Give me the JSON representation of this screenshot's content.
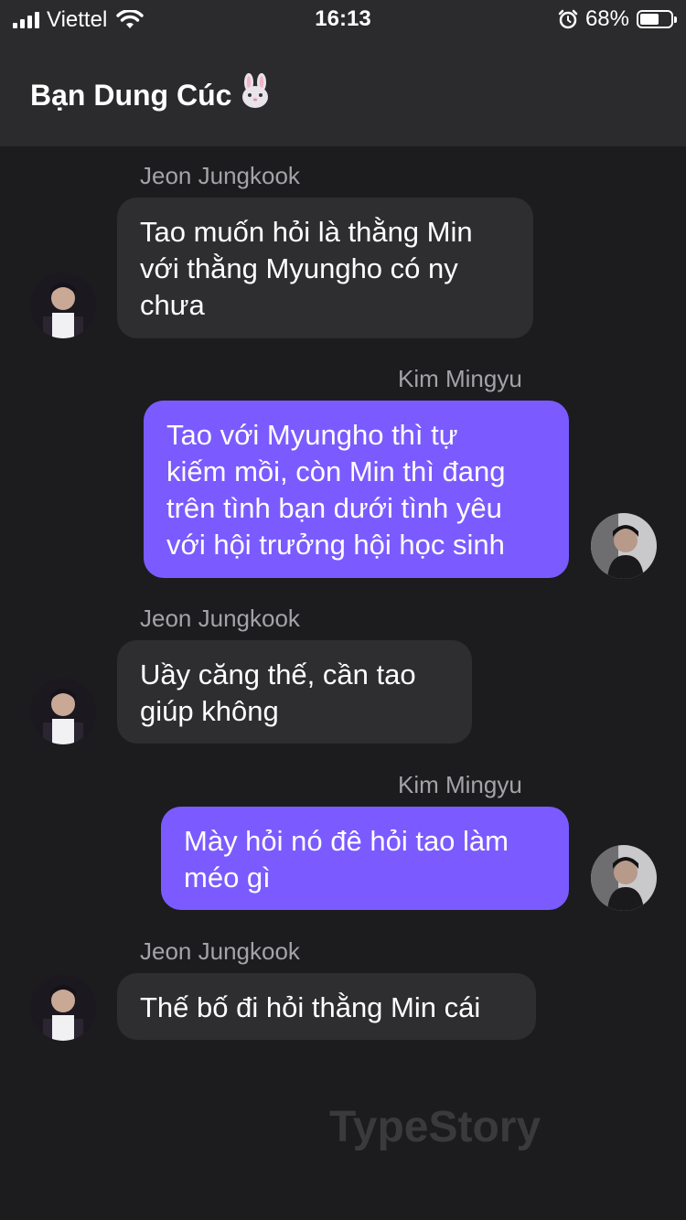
{
  "status_bar": {
    "carrier": "Viettel",
    "time": "16:13",
    "battery": "68%",
    "battery_level": 0.68
  },
  "header": {
    "title": "Bạn Dung Cúc",
    "emoji": "🐰"
  },
  "messages": [
    {
      "sender": "Jeon Jungkook",
      "side": "left",
      "lines": [
        "Tao muốn hỏi là thằng Min",
        "với thằng Myungho có ny",
        "chưa"
      ]
    },
    {
      "sender": "Kim Mingyu",
      "side": "right",
      "lines": [
        "Tao với Myungho thì tự",
        "kiếm mồi, còn Min thì đang",
        "trên tình bạn dưới tình yêu",
        "với hội trưởng hội học sinh"
      ]
    },
    {
      "sender": "Jeon Jungkook",
      "side": "left",
      "lines": [
        "Uầy căng thế, cần tao",
        "giúp không"
      ]
    },
    {
      "sender": "Kim Mingyu",
      "side": "right",
      "lines": [
        "Mày hỏi nó đê hỏi tao làm",
        "méo gì"
      ]
    },
    {
      "sender": "Jeon Jungkook",
      "side": "left",
      "lines": [
        "Thế bố đi hỏi thằng Min cái"
      ]
    }
  ],
  "watermark": "TypeStory",
  "colors": {
    "outgoing": "#7b5bff",
    "incoming": "#2e2e31",
    "background": "#1c1c1e"
  }
}
